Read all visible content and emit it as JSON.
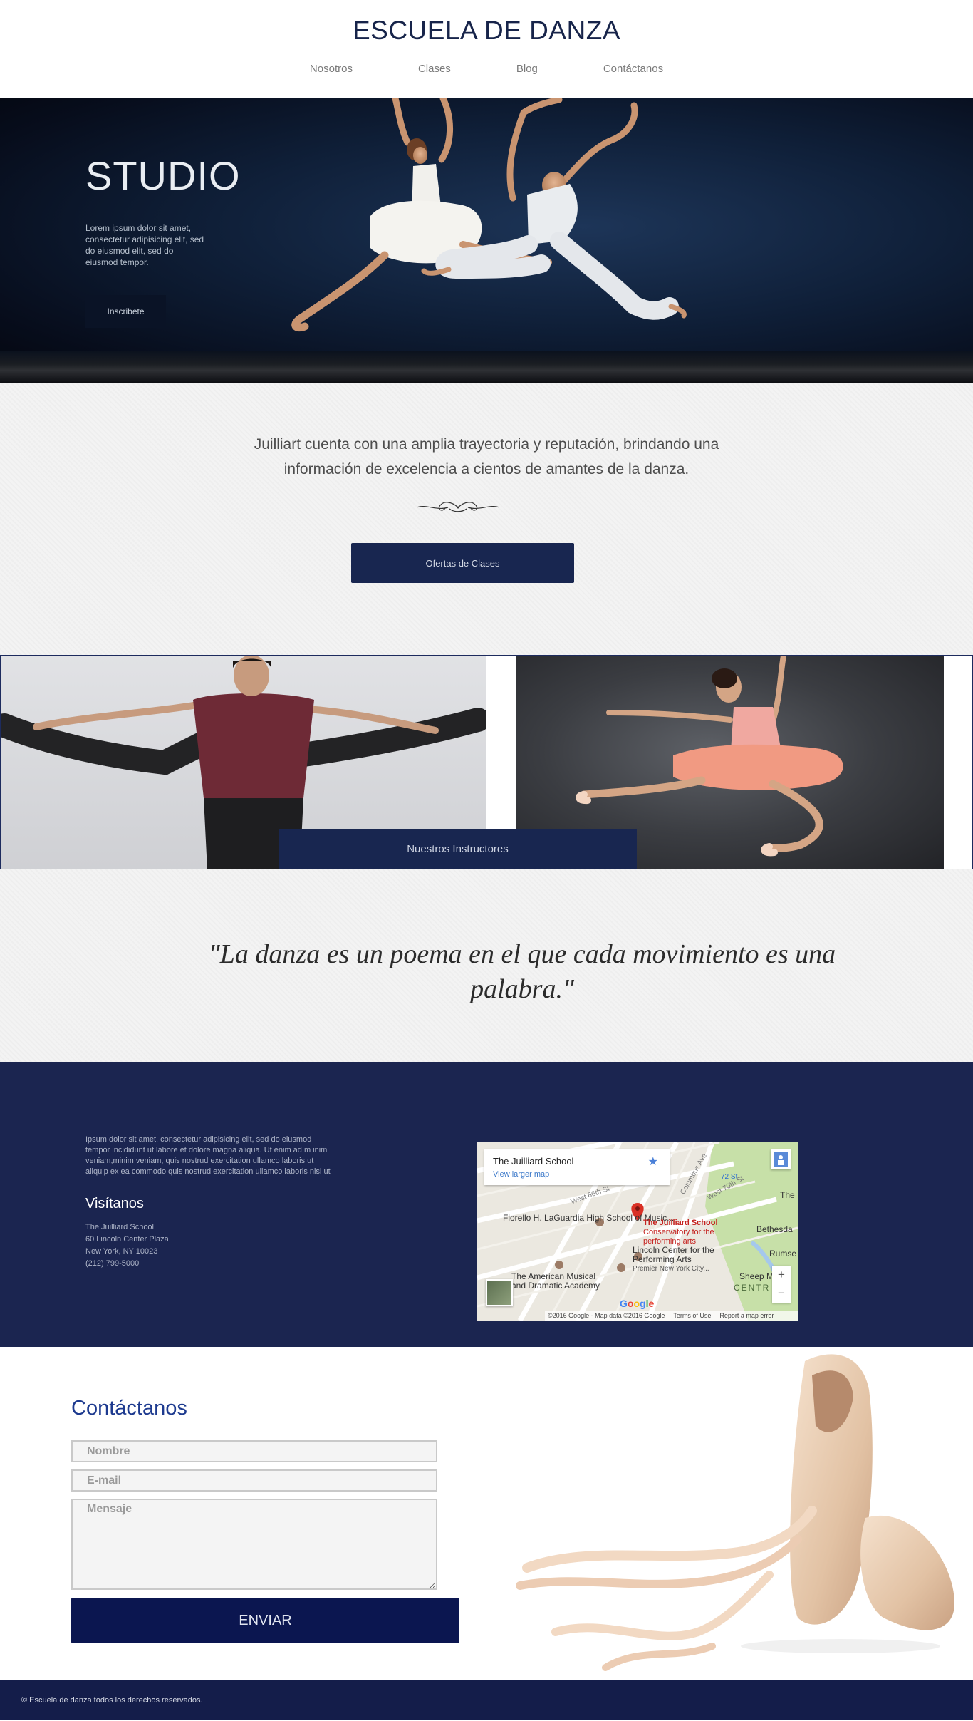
{
  "header": {
    "title": "ESCUELA DE DANZA",
    "nav": [
      "Nosotros",
      "Clases",
      "Blog",
      "Contáctanos"
    ]
  },
  "hero": {
    "title": "STUDIO",
    "text": "Lorem ipsum dolor sit amet, consectetur adipisicing elit, sed do eiusmod elit, sed do eiusmod tempor.",
    "button": "Inscribete"
  },
  "intro": {
    "text": "Juilliart cuenta con una amplia trayectoria y reputación, brindando una información de excelencia a cientos de amantes de la danza.",
    "button": "Ofertas de Clases"
  },
  "gallery": {
    "label": "Nuestros Instructores"
  },
  "quote": {
    "text": "\"La danza es un poema en el que cada movimiento es una palabra.\""
  },
  "visit": {
    "paragraph": "Ipsum dolor sit amet, consectetur adipisicing elit, sed do eiusmod tempor incididunt ut labore et dolore magna aliqua. Ut enim ad m inim veniam,minim veniam, quis nostrud exercitation ullamco laboris ut aliquip ex ea commodo quis nostrud exercitation ullamco laboris nisi ut",
    "heading": "Visítanos",
    "address": [
      "The Juilliard School",
      "60 Lincoln Center Plaza",
      "New York, NY 10023",
      "(212) 799-5000"
    ]
  },
  "map": {
    "card_title": "The Juilliard School",
    "card_link": "View larger map",
    "labels": {
      "laguardia": "Fiorello H. LaGuardia High School of Music...",
      "juilliard": "The Juilliard School",
      "juilliard_sub": "Conservatory for the performing arts",
      "lincoln": "Lincoln Center for the Performing Arts",
      "lincoln_sub": "Premier New York City...",
      "american": "The American Musical and Dramatic Academy",
      "bethesda": "Bethesda",
      "rumsey": "Rumse",
      "sheep": "Sheep M",
      "centr": "CENTR",
      "the": "The",
      "street_72": "72 St",
      "w66": "West 66th St",
      "w70": "West 70th St",
      "columbus": "Columbus Ave"
    },
    "footer": [
      "©2016 Google - Map data ©2016 Google",
      "Terms of Use",
      "Report a map error"
    ],
    "google": "Google",
    "zoom_in": "+",
    "zoom_out": "−"
  },
  "contact": {
    "title": "Contáctanos",
    "name_placeholder": "Nombre",
    "email_placeholder": "E-mail",
    "message_placeholder": "Mensaje",
    "send": "ENVIAR"
  },
  "footer": {
    "text": "© Escuela de danza todos los derechos reservados."
  },
  "colors": {
    "navy": "#182650",
    "visit_bg": "#1b2550",
    "footer_bg": "#141d4a",
    "title": "#17244a",
    "contact_title": "#1d3a8f"
  }
}
